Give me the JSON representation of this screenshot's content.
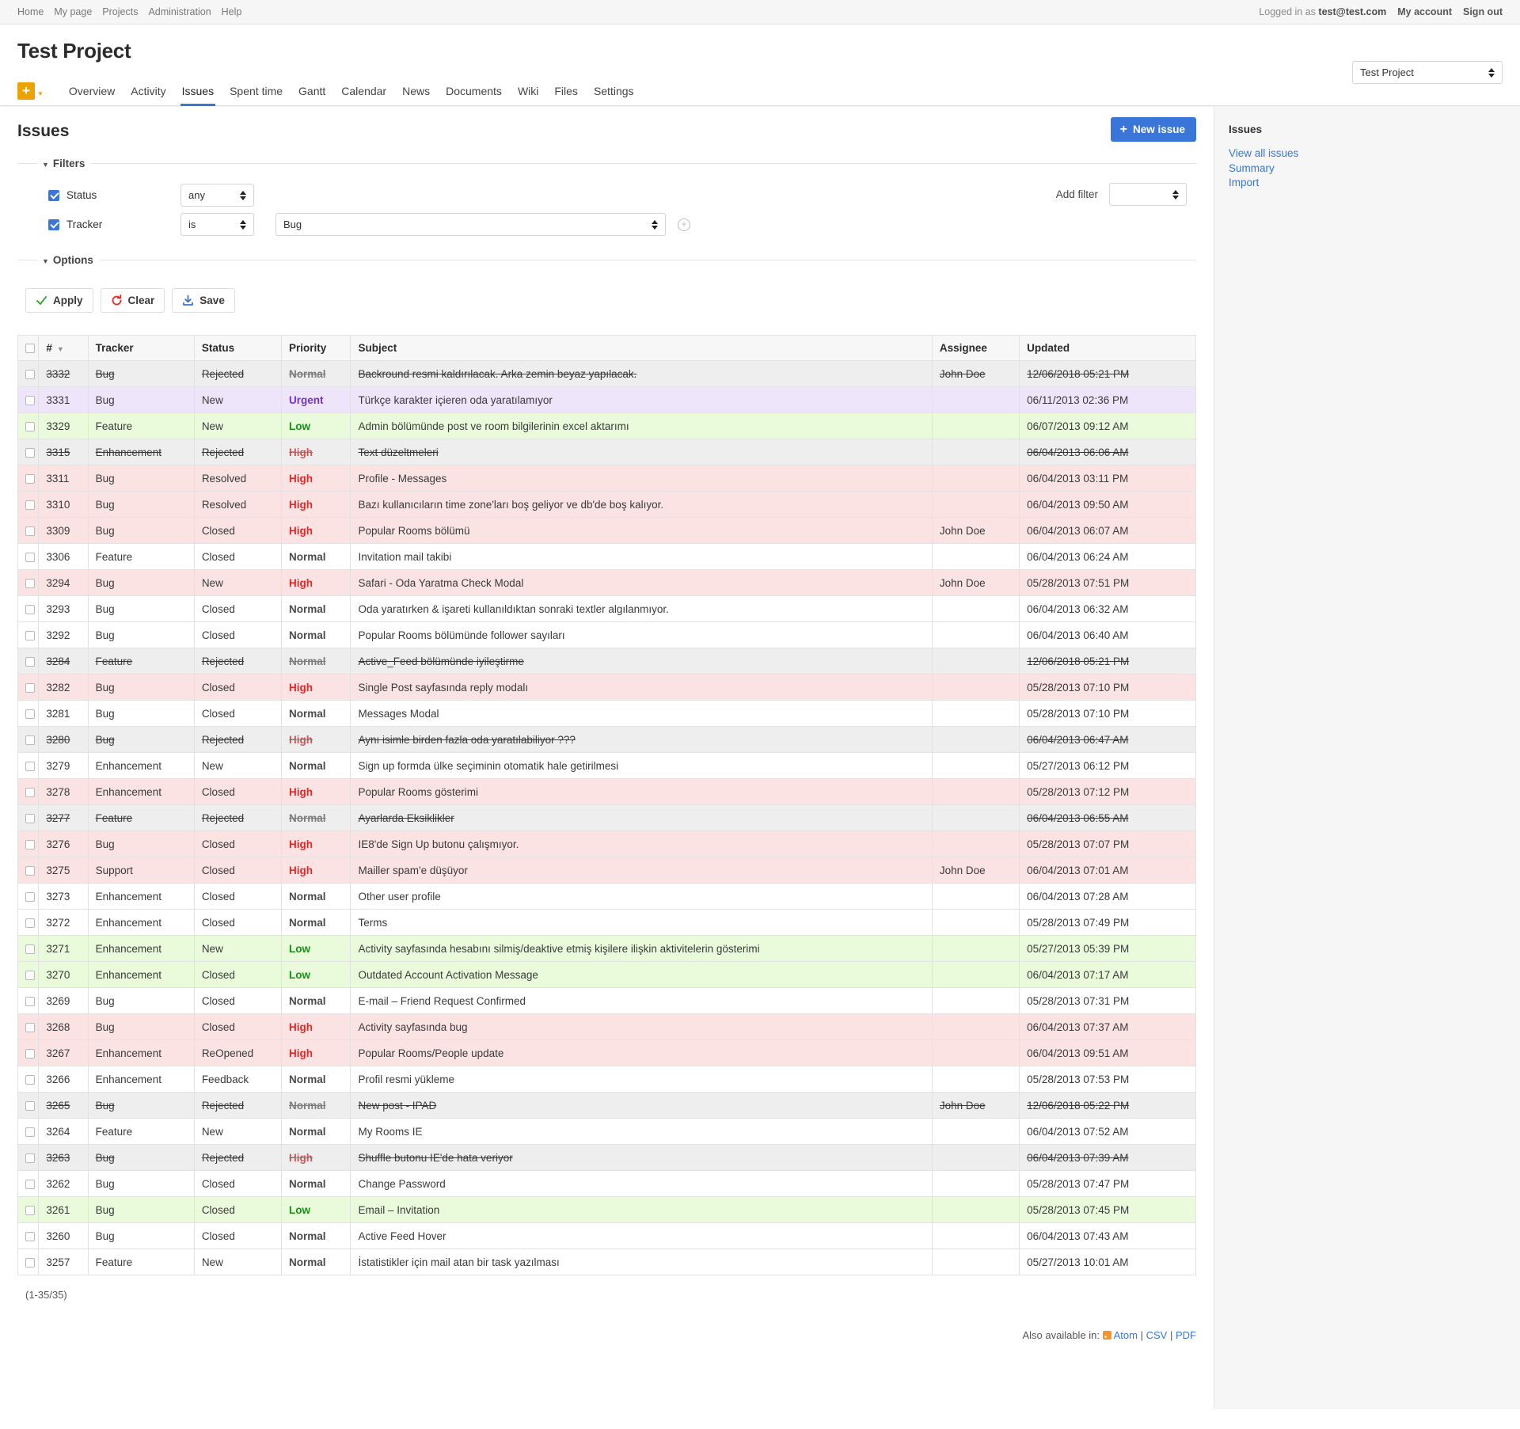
{
  "top_menu": {
    "left": [
      "Home",
      "My page",
      "Projects",
      "Administration",
      "Help"
    ],
    "logged_in_prefix": "Logged in as",
    "logged_in_user": "test@test.com",
    "my_account": "My account",
    "sign_out": "Sign out"
  },
  "header": {
    "project_title": "Test Project",
    "project_jump_value": "Test Project"
  },
  "main_menu": {
    "add_label": "+",
    "tabs": [
      {
        "label": "Overview",
        "selected": false
      },
      {
        "label": "Activity",
        "selected": false
      },
      {
        "label": "Issues",
        "selected": true
      },
      {
        "label": "Spent time",
        "selected": false
      },
      {
        "label": "Gantt",
        "selected": false
      },
      {
        "label": "Calendar",
        "selected": false
      },
      {
        "label": "News",
        "selected": false
      },
      {
        "label": "Documents",
        "selected": false
      },
      {
        "label": "Wiki",
        "selected": false
      },
      {
        "label": "Files",
        "selected": false
      },
      {
        "label": "Settings",
        "selected": false
      }
    ]
  },
  "content": {
    "page_title": "Issues",
    "new_issue_label": "New issue"
  },
  "filters": {
    "legend": "Filters",
    "options_legend": "Options",
    "add_filter_label": "Add filter",
    "add_filter_value": "",
    "rows": [
      {
        "name": "Status",
        "operator": "any",
        "value": null
      },
      {
        "name": "Tracker",
        "operator": "is",
        "value": "Bug"
      }
    ]
  },
  "actions": {
    "apply": "Apply",
    "clear": "Clear",
    "save": "Save"
  },
  "table": {
    "columns": [
      "#",
      "Tracker",
      "Status",
      "Priority",
      "Subject",
      "Assignee",
      "Updated"
    ],
    "sorted_column": "#",
    "rows": [
      {
        "id": "3332",
        "tracker": "Bug",
        "status": "Rejected",
        "priority": "Normal",
        "subject": "Backround resmi kaldırılacak. Arka zemin beyaz yapılacak.",
        "assignee": "John Doe",
        "updated": "12/06/2018 05:21 PM",
        "closed": true,
        "prio_class": "normal"
      },
      {
        "id": "3331",
        "tracker": "Bug",
        "status": "New",
        "priority": "Urgent",
        "subject": "Türkçe karakter içieren oda yaratılamıyor",
        "assignee": "",
        "updated": "06/11/2013 02:36 PM",
        "closed": false,
        "prio_class": "urgent"
      },
      {
        "id": "3329",
        "tracker": "Feature",
        "status": "New",
        "priority": "Low",
        "subject": "Admin bölümünde post ve room bilgilerinin excel aktarımı",
        "assignee": "",
        "updated": "06/07/2013 09:12 AM",
        "closed": false,
        "prio_class": "low"
      },
      {
        "id": "3315",
        "tracker": "Enhancement",
        "status": "Rejected",
        "priority": "High",
        "subject": "Text düzeltmeleri",
        "assignee": "",
        "updated": "06/04/2013 06:06 AM",
        "closed": true,
        "prio_class": "high"
      },
      {
        "id": "3311",
        "tracker": "Bug",
        "status": "Resolved",
        "priority": "High",
        "subject": "Profile - Messages",
        "assignee": "",
        "updated": "06/04/2013 03:11 PM",
        "closed": false,
        "prio_class": "high"
      },
      {
        "id": "3310",
        "tracker": "Bug",
        "status": "Resolved",
        "priority": "High",
        "subject": "Bazı kullanıcıların time zone'ları boş geliyor ve db'de boş kalıyor.",
        "assignee": "",
        "updated": "06/04/2013 09:50 AM",
        "closed": false,
        "prio_class": "high"
      },
      {
        "id": "3309",
        "tracker": "Bug",
        "status": "Closed",
        "priority": "High",
        "subject": "Popular Rooms bölümü",
        "assignee": "John Doe",
        "updated": "06/04/2013 06:07 AM",
        "closed": false,
        "prio_class": "high"
      },
      {
        "id": "3306",
        "tracker": "Feature",
        "status": "Closed",
        "priority": "Normal",
        "subject": "Invitation mail takibi",
        "assignee": "",
        "updated": "06/04/2013 06:24 AM",
        "closed": false,
        "prio_class": "normal"
      },
      {
        "id": "3294",
        "tracker": "Bug",
        "status": "New",
        "priority": "High",
        "subject": "Safari - Oda Yaratma Check Modal",
        "assignee": "John Doe",
        "updated": "05/28/2013 07:51 PM",
        "closed": false,
        "prio_class": "high"
      },
      {
        "id": "3293",
        "tracker": "Bug",
        "status": "Closed",
        "priority": "Normal",
        "subject": "Oda yaratırken & işareti kullanıldıktan sonraki textler algılanmıyor.",
        "assignee": "",
        "updated": "06/04/2013 06:32 AM",
        "closed": false,
        "prio_class": "normal"
      },
      {
        "id": "3292",
        "tracker": "Bug",
        "status": "Closed",
        "priority": "Normal",
        "subject": "Popular Rooms bölümünde follower sayıları",
        "assignee": "",
        "updated": "06/04/2013 06:40 AM",
        "closed": false,
        "prio_class": "normal"
      },
      {
        "id": "3284",
        "tracker": "Feature",
        "status": "Rejected",
        "priority": "Normal",
        "subject": "Active_Feed bölümünde iyileştirme",
        "assignee": "",
        "updated": "12/06/2018 05:21 PM",
        "closed": true,
        "prio_class": "normal"
      },
      {
        "id": "3282",
        "tracker": "Bug",
        "status": "Closed",
        "priority": "High",
        "subject": "Single Post sayfasında reply modalı",
        "assignee": "",
        "updated": "05/28/2013 07:10 PM",
        "closed": false,
        "prio_class": "high"
      },
      {
        "id": "3281",
        "tracker": "Bug",
        "status": "Closed",
        "priority": "Normal",
        "subject": "Messages Modal",
        "assignee": "",
        "updated": "05/28/2013 07:10 PM",
        "closed": false,
        "prio_class": "normal"
      },
      {
        "id": "3280",
        "tracker": "Bug",
        "status": "Rejected",
        "priority": "High",
        "subject": "Aynı isimle birden fazla oda yaratılabiliyor ???",
        "assignee": "",
        "updated": "06/04/2013 06:47 AM",
        "closed": true,
        "prio_class": "high"
      },
      {
        "id": "3279",
        "tracker": "Enhancement",
        "status": "New",
        "priority": "Normal",
        "subject": "Sign up formda ülke seçiminin otomatik hale getirilmesi",
        "assignee": "",
        "updated": "05/27/2013 06:12 PM",
        "closed": false,
        "prio_class": "normal"
      },
      {
        "id": "3278",
        "tracker": "Enhancement",
        "status": "Closed",
        "priority": "High",
        "subject": "Popular Rooms gösterimi",
        "assignee": "",
        "updated": "05/28/2013 07:12 PM",
        "closed": false,
        "prio_class": "high"
      },
      {
        "id": "3277",
        "tracker": "Feature",
        "status": "Rejected",
        "priority": "Normal",
        "subject": "Ayarlarda Eksiklikler",
        "assignee": "",
        "updated": "06/04/2013 06:55 AM",
        "closed": true,
        "prio_class": "normal"
      },
      {
        "id": "3276",
        "tracker": "Bug",
        "status": "Closed",
        "priority": "High",
        "subject": "IE8'de Sign Up butonu çalışmıyor.",
        "assignee": "",
        "updated": "05/28/2013 07:07 PM",
        "closed": false,
        "prio_class": "high"
      },
      {
        "id": "3275",
        "tracker": "Support",
        "status": "Closed",
        "priority": "High",
        "subject": "Mailler spam'e düşüyor",
        "assignee": "John Doe",
        "updated": "06/04/2013 07:01 AM",
        "closed": false,
        "prio_class": "high"
      },
      {
        "id": "3273",
        "tracker": "Enhancement",
        "status": "Closed",
        "priority": "Normal",
        "subject": "Other user profile",
        "assignee": "",
        "updated": "06/04/2013 07:28 AM",
        "closed": false,
        "prio_class": "normal"
      },
      {
        "id": "3272",
        "tracker": "Enhancement",
        "status": "Closed",
        "priority": "Normal",
        "subject": "Terms",
        "assignee": "",
        "updated": "05/28/2013 07:49 PM",
        "closed": false,
        "prio_class": "normal"
      },
      {
        "id": "3271",
        "tracker": "Enhancement",
        "status": "New",
        "priority": "Low",
        "subject": "Activity sayfasında hesabını silmiş/deaktive etmiş kişilere ilişkin aktivitelerin gösterimi",
        "assignee": "",
        "updated": "05/27/2013 05:39 PM",
        "closed": false,
        "prio_class": "low"
      },
      {
        "id": "3270",
        "tracker": "Enhancement",
        "status": "Closed",
        "priority": "Low",
        "subject": "Outdated Account Activation Message",
        "assignee": "",
        "updated": "06/04/2013 07:17 AM",
        "closed": false,
        "prio_class": "low"
      },
      {
        "id": "3269",
        "tracker": "Bug",
        "status": "Closed",
        "priority": "Normal",
        "subject": "E-mail – Friend Request Confirmed",
        "assignee": "",
        "updated": "05/28/2013 07:31 PM",
        "closed": false,
        "prio_class": "normal"
      },
      {
        "id": "3268",
        "tracker": "Bug",
        "status": "Closed",
        "priority": "High",
        "subject": "Activity sayfasında bug",
        "assignee": "",
        "updated": "06/04/2013 07:37 AM",
        "closed": false,
        "prio_class": "high"
      },
      {
        "id": "3267",
        "tracker": "Enhancement",
        "status": "ReOpened",
        "priority": "High",
        "subject": "Popular Rooms/People update",
        "assignee": "",
        "updated": "06/04/2013 09:51 AM",
        "closed": false,
        "prio_class": "high"
      },
      {
        "id": "3266",
        "tracker": "Enhancement",
        "status": "Feedback",
        "priority": "Normal",
        "subject": "Profil resmi yükleme",
        "assignee": "",
        "updated": "05/28/2013 07:53 PM",
        "closed": false,
        "prio_class": "normal"
      },
      {
        "id": "3265",
        "tracker": "Bug",
        "status": "Rejected",
        "priority": "Normal",
        "subject": "New post - IPAD",
        "assignee": "John Doe",
        "updated": "12/06/2018 05:22 PM",
        "closed": true,
        "prio_class": "normal"
      },
      {
        "id": "3264",
        "tracker": "Feature",
        "status": "New",
        "priority": "Normal",
        "subject": "My Rooms IE",
        "assignee": "",
        "updated": "06/04/2013 07:52 AM",
        "closed": false,
        "prio_class": "normal"
      },
      {
        "id": "3263",
        "tracker": "Bug",
        "status": "Rejected",
        "priority": "High",
        "subject": "Shuffle butonu IE'de hata veriyor",
        "assignee": "",
        "updated": "06/04/2013 07:39 AM",
        "closed": true,
        "prio_class": "high"
      },
      {
        "id": "3262",
        "tracker": "Bug",
        "status": "Closed",
        "priority": "Normal",
        "subject": "Change Password",
        "assignee": "",
        "updated": "05/28/2013 07:47 PM",
        "closed": false,
        "prio_class": "normal"
      },
      {
        "id": "3261",
        "tracker": "Bug",
        "status": "Closed",
        "priority": "Low",
        "subject": "Email – Invitation",
        "assignee": "",
        "updated": "05/28/2013 07:45 PM",
        "closed": false,
        "prio_class": "low"
      },
      {
        "id": "3260",
        "tracker": "Bug",
        "status": "Closed",
        "priority": "Normal",
        "subject": "Active Feed Hover",
        "assignee": "",
        "updated": "06/04/2013 07:43 AM",
        "closed": false,
        "prio_class": "normal"
      },
      {
        "id": "3257",
        "tracker": "Feature",
        "status": "New",
        "priority": "Normal",
        "subject": "İstatistikler için mail atan bir task yazılması",
        "assignee": "",
        "updated": "05/27/2013 10:01 AM",
        "closed": false,
        "prio_class": "normal"
      }
    ]
  },
  "footer": {
    "counts": "(1-35/35)",
    "also_available": "Also available in:",
    "atom": "Atom",
    "csv": "CSV",
    "pdf": "PDF",
    "sep": "|"
  },
  "sidebar": {
    "title": "Issues",
    "links": [
      "View all issues",
      "Summary",
      "Import"
    ]
  }
}
